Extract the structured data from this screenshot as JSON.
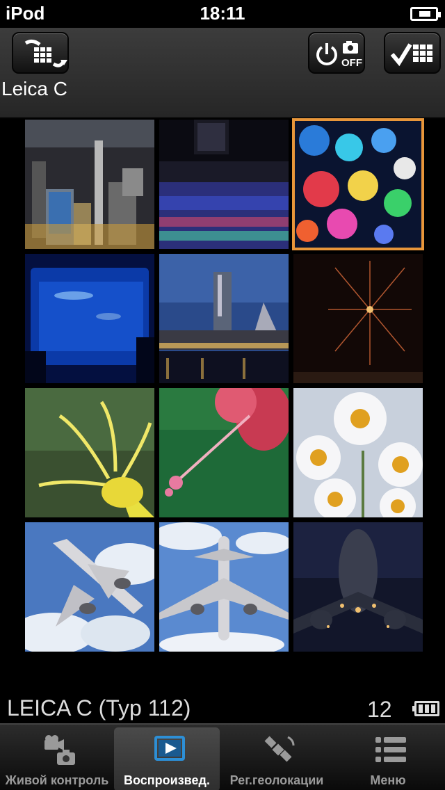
{
  "status_bar": {
    "carrier": "iPod",
    "time": "18:11"
  },
  "header": {
    "camera_name": "Leica C",
    "buttons": {
      "switch_view_icon": "rotate-grid-icon",
      "camera_off_label": "OFF",
      "select_icon": "checkmark-grid-icon"
    }
  },
  "thumbnails": [
    {
      "name": "city-night-aerial-photo",
      "selected": false
    },
    {
      "name": "illumination-field-photo",
      "selected": false
    },
    {
      "name": "bokeh-lights-photo",
      "selected": true
    },
    {
      "name": "aquarium-photo",
      "selected": false
    },
    {
      "name": "tower-waterfront-photo",
      "selected": false
    },
    {
      "name": "fireworks-photo",
      "selected": false
    },
    {
      "name": "yellow-flower-photo",
      "selected": false
    },
    {
      "name": "pink-flower-photo",
      "selected": false
    },
    {
      "name": "daffodils-photo",
      "selected": false
    },
    {
      "name": "airplane-takeoff-photo",
      "selected": false
    },
    {
      "name": "airplane-overhead-photo",
      "selected": false
    },
    {
      "name": "airplane-night-photo",
      "selected": false
    }
  ],
  "footer": {
    "model": "LEICA C (Typ 112)",
    "image_count": "12",
    "battery_level": 1.0
  },
  "tabs": [
    {
      "label": "Живой контроль",
      "icon": "camera-icon",
      "active": false
    },
    {
      "label": "Воспроизвед.",
      "icon": "playback-icon",
      "active": true
    },
    {
      "label": "Рег.геолокации",
      "icon": "satellite-icon",
      "active": false
    },
    {
      "label": "Меню",
      "icon": "menu-list-icon",
      "active": false
    }
  ],
  "colors": {
    "selection": "#e8963a",
    "accent_blue": "#2d8fd6"
  }
}
